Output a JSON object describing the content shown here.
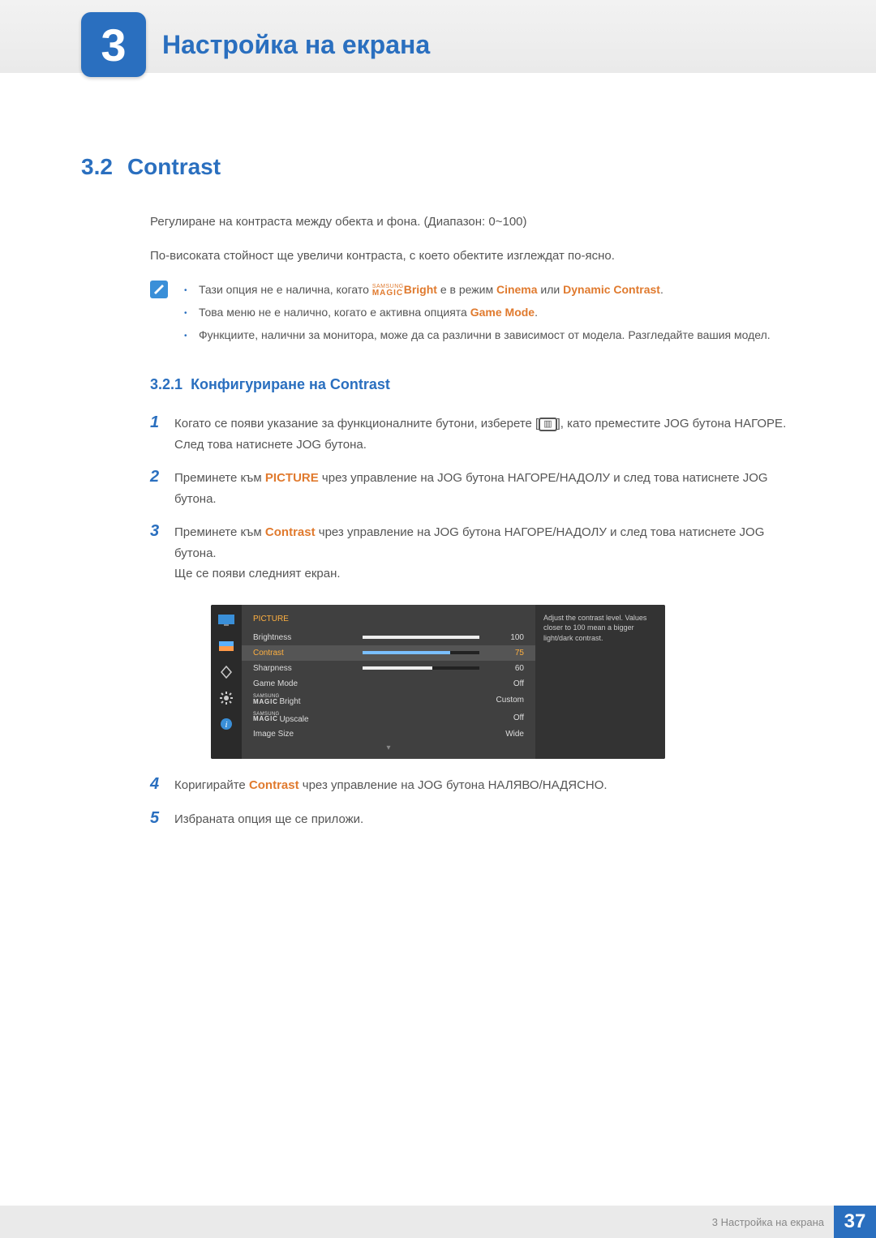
{
  "chapter": {
    "number": "3",
    "title": "Настройка на екрана"
  },
  "section": {
    "number": "3.2",
    "title": "Contrast"
  },
  "intro": {
    "p1": "Регулиране на контраста между обекта и фона. (Диапазон: 0~100)",
    "p2": "По-високата стойност ще увеличи контраста, с което обектите изглеждат по-ясно."
  },
  "notes": {
    "n1_a": "Тази опция не е налична, когато ",
    "n1_mbrand": "SAMSUNG",
    "n1_mmain": "MAGIC",
    "n1_bright": "Bright",
    "n1_b": " е в режим ",
    "n1_cinema": "Cinema",
    "n1_or": " или ",
    "n1_dyn": "Dynamic Contrast",
    "n1_dot": ".",
    "n2_a": "Това меню не е налично, когато е активна опцията ",
    "n2_game": "Game Mode",
    "n2_dot": ".",
    "n3": "Функциите, налични за монитора, може да са различни в зависимост от модела. Разгледайте вашия модел."
  },
  "subsection": {
    "number": "3.2.1",
    "title": "Конфигуриране на Contrast"
  },
  "steps": {
    "s1_a": "Когато се появи указание за функционалните бутони, изберете [",
    "s1_b": "], като преместите JOG бутона НАГОРЕ.",
    "s1_c": "След това натиснете JOG бутона.",
    "s2_a": "Преминете към ",
    "s2_pic": "PICTURE",
    "s2_b": " чрез управление на JOG бутона НАГОРЕ/НАДОЛУ и след това натиснете JOG бутона.",
    "s3_a": "Преминете към ",
    "s3_con": "Contrast",
    "s3_b": " чрез управление на JOG бутона НАГОРЕ/НАДОЛУ и след това натиснете JOG бутона.",
    "s3_c": "Ще се появи следният екран.",
    "s4_a": "Коригирайте ",
    "s4_con": "Contrast",
    "s4_b": " чрез управление на JOG бутона НАЛЯВО/НАДЯСНО.",
    "s5": "Избраната опция ще се приложи."
  },
  "osd": {
    "title": "PICTURE",
    "rows": {
      "brightness": {
        "label": "Brightness",
        "val": "100"
      },
      "contrast": {
        "label": "Contrast",
        "val": "75"
      },
      "sharpness": {
        "label": "Sharpness",
        "val": "60"
      },
      "game": {
        "label": "Game Mode",
        "val": "Off"
      },
      "magicbright": {
        "sup": "SAMSUNG",
        "main": "MAGIC",
        "suffix": "Bright",
        "val": "Custom"
      },
      "magicupscale": {
        "sup": "SAMSUNG",
        "main": "MAGIC",
        "suffix": "Upscale",
        "val": "Off"
      },
      "imgsize": {
        "label": "Image Size",
        "val": "Wide"
      }
    },
    "info": "Adjust the contrast level. Values closer to 100 mean a bigger light/dark contrast."
  },
  "footer": {
    "text": "3 Настройка на екрана",
    "page": "37"
  }
}
